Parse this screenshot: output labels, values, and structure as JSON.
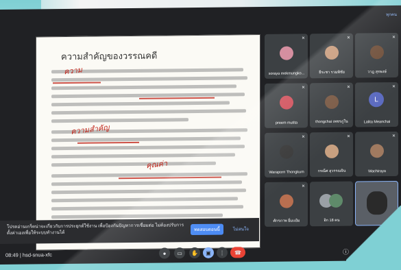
{
  "document": {
    "title": "ความสำคัญของวรรณคดี",
    "annotations": [
      "ความ",
      "ความสำคัญ",
      "คุณค่า"
    ]
  },
  "notification": {
    "text": "โปรดอ่านเกร็ดน่าจะเกี่ยวกับการประยุกต์ใช้งาน เพื่อป้องกันปัญหาการเชื่อมต่อ ไม่ต้องปรับการตั้งค่าเองเพื่อให้ระบบทำงานได้",
    "primary_button": "ทดสอบตอนนี้",
    "close_button": "ไม่สนใจ"
  },
  "grid": {
    "corner_label": "ทุกคน",
    "participants": [
      {
        "name": "soraya mekmungko..."
      },
      {
        "name": "ธีระชา รวมพิชัย"
      },
      {
        "name": "วาฎ สุรพงษ์"
      },
      {
        "name": "preem mutita"
      },
      {
        "name": "thongchai เพชรภูใน"
      },
      {
        "name": "Lalita Meanchai",
        "letter": "L"
      },
      {
        "name": "Waraporn Thongkum"
      },
      {
        "name": "กรณิ์ศ สุวรรณจิน"
      },
      {
        "name": "Wachiraya"
      },
      {
        "name": "ศักรภาพ ยิ้มแย้ม"
      },
      {
        "name": "อิก 18 คน"
      },
      {
        "name": ""
      }
    ]
  },
  "bottom_bar": {
    "time": "08:49",
    "separator": "|",
    "meeting_code": "hsd-snua-xfc"
  },
  "icons": {
    "mic": "mic-icon",
    "camera": "camera-icon",
    "hand": "hand-icon",
    "present": "present-icon",
    "more": "more-icon",
    "end": "end-call-icon",
    "info": "info-icon"
  }
}
